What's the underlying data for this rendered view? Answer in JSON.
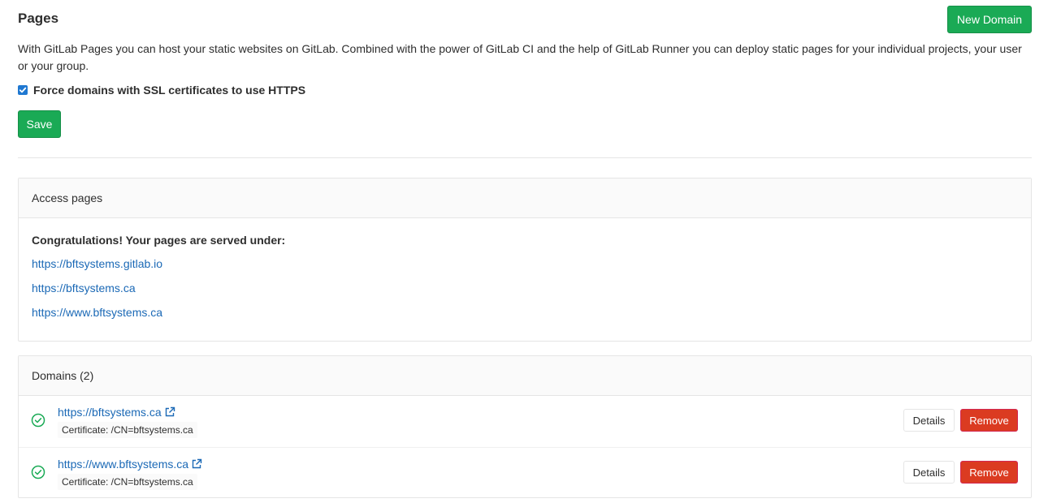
{
  "header": {
    "title": "Pages",
    "new_domain_label": "New Domain"
  },
  "intro": "With GitLab Pages you can host your static websites on GitLab. Combined with the power of GitLab CI and the help of GitLab Runner you can deploy static pages for your individual projects, your user or your group.",
  "force_https": {
    "label": "Force domains with SSL certificates to use HTTPS",
    "checked": true
  },
  "save_label": "Save",
  "access_pages": {
    "header": "Access pages",
    "congrats": "Congratulations! Your pages are served under:",
    "links": [
      "https://bftsystems.gitlab.io",
      "https://bftsystems.ca",
      "https://www.bftsystems.ca"
    ]
  },
  "domains": {
    "header": "Domains (2)",
    "items": [
      {
        "url": "https://bftsystems.ca",
        "certificate": "Certificate: /CN=bftsystems.ca",
        "details_label": "Details",
        "remove_label": "Remove"
      },
      {
        "url": "https://www.bftsystems.ca",
        "certificate": "Certificate: /CN=bftsystems.ca",
        "details_label": "Details",
        "remove_label": "Remove"
      }
    ]
  },
  "colors": {
    "success": "#1aaa55",
    "danger": "#db3b21",
    "link": "#1b69b6",
    "checkbox": "#1f78d1"
  }
}
